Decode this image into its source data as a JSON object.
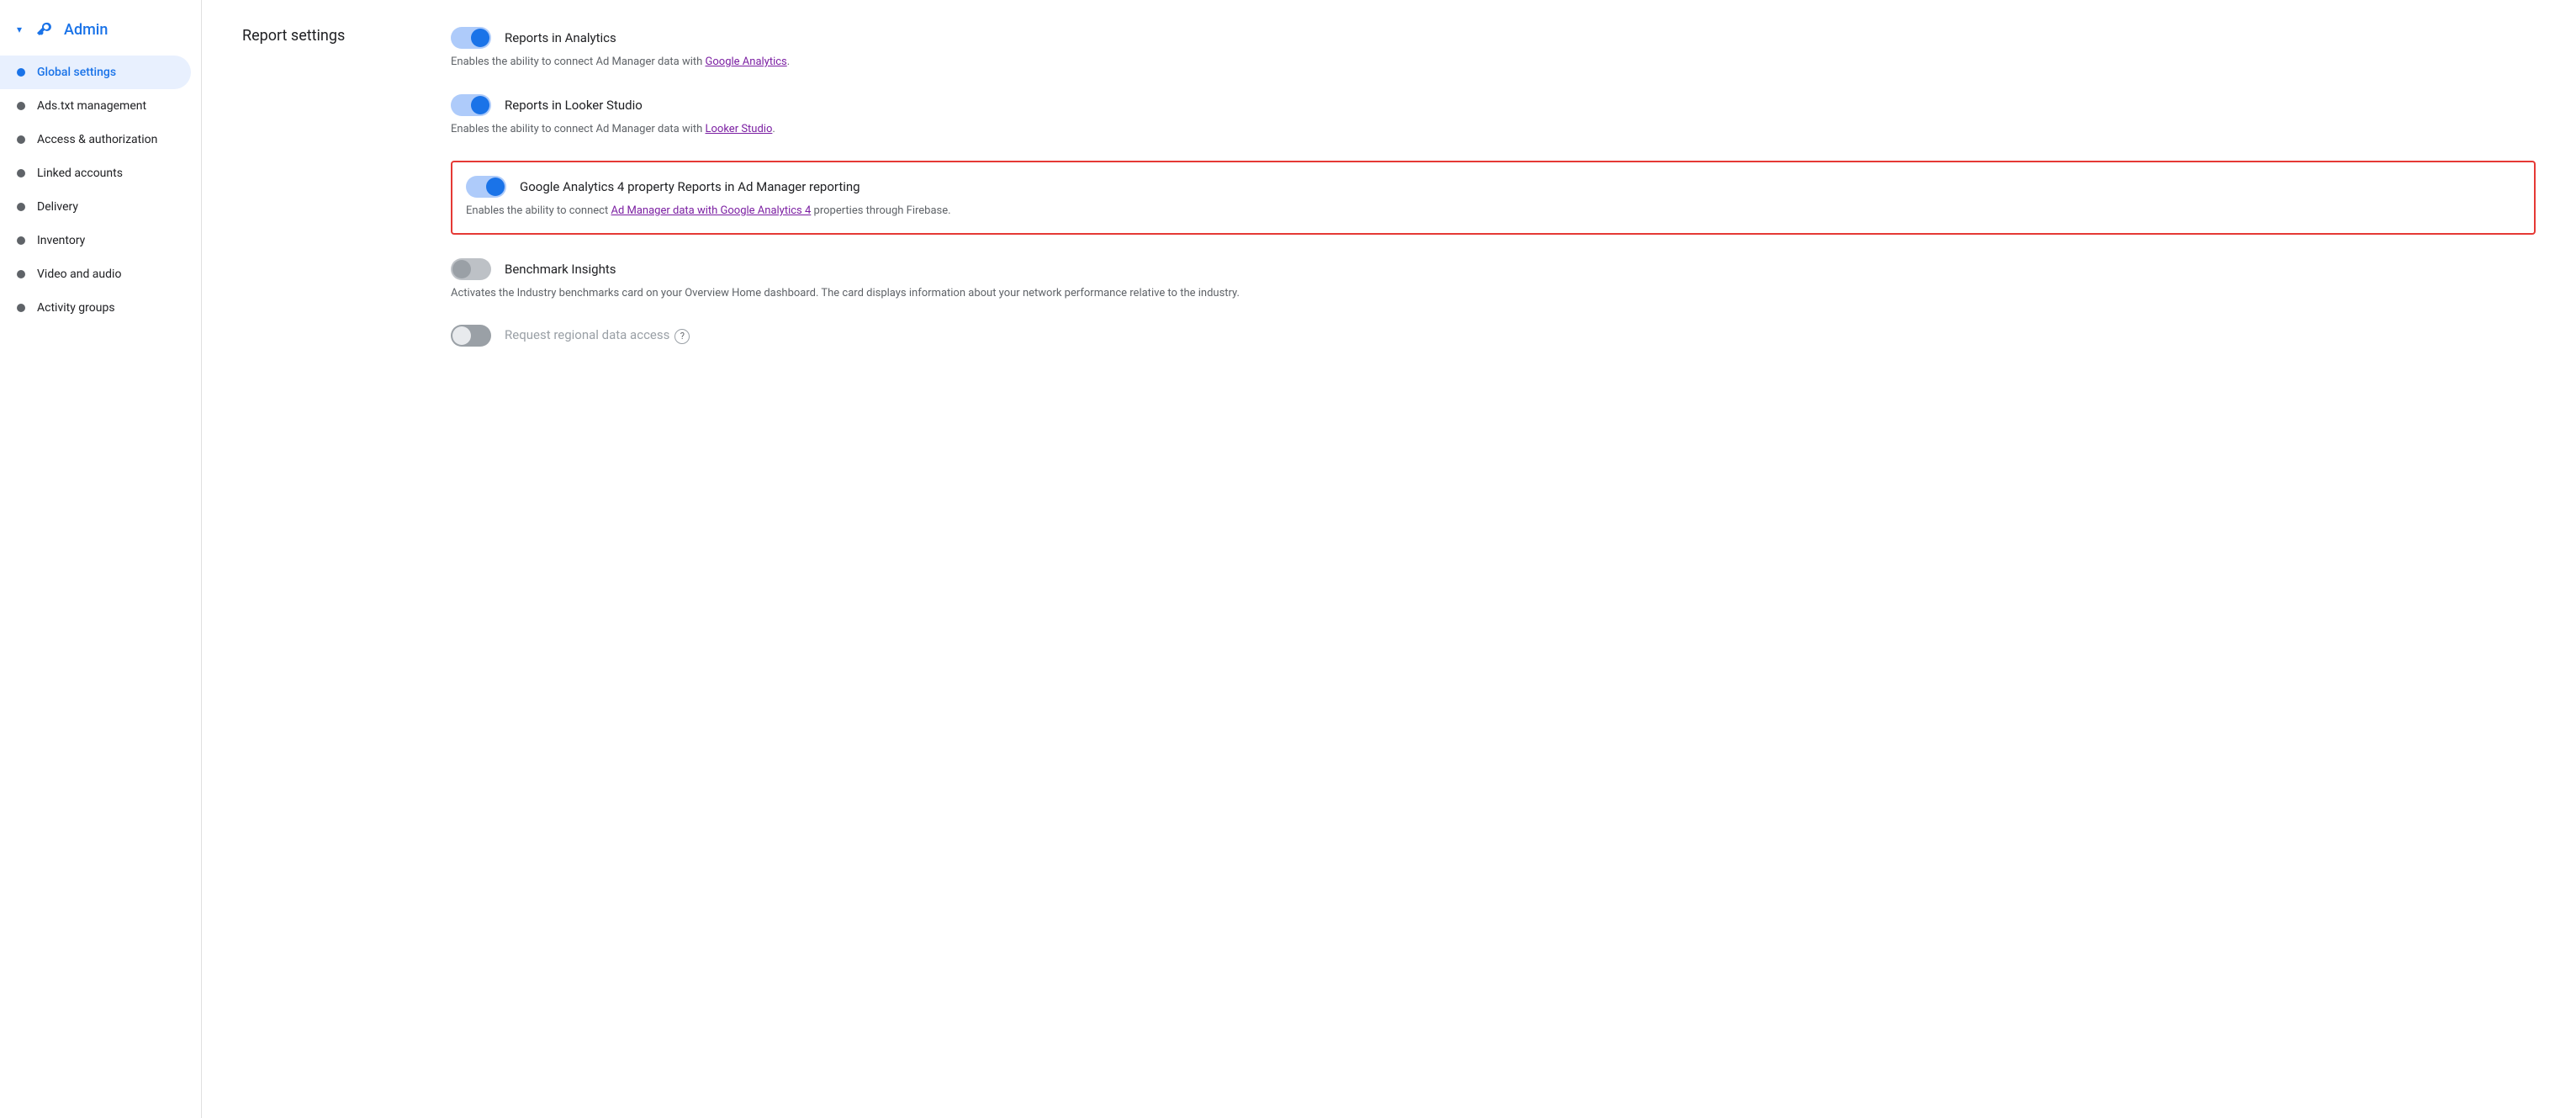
{
  "sidebar": {
    "admin_label": "Admin",
    "items": [
      {
        "id": "global-settings",
        "label": "Global settings",
        "active": true
      },
      {
        "id": "ads-txt",
        "label": "Ads.txt management",
        "active": false
      },
      {
        "id": "access-auth",
        "label": "Access & authorization",
        "active": false
      },
      {
        "id": "linked-accounts",
        "label": "Linked accounts",
        "active": false
      },
      {
        "id": "delivery",
        "label": "Delivery",
        "active": false
      },
      {
        "id": "inventory",
        "label": "Inventory",
        "active": false
      },
      {
        "id": "video-audio",
        "label": "Video and audio",
        "active": false
      },
      {
        "id": "activity-groups",
        "label": "Activity groups",
        "active": false
      }
    ]
  },
  "main": {
    "section_title": "Report settings",
    "settings": [
      {
        "id": "reports-analytics",
        "label": "Reports in Analytics",
        "description": "Enables the ability to connect Ad Manager data with ",
        "link_text": "Google Analytics",
        "description_after": ".",
        "enabled": true,
        "highlighted": false
      },
      {
        "id": "reports-looker",
        "label": "Reports in Looker Studio",
        "description": "Enables the ability to connect Ad Manager data with ",
        "link_text": "Looker Studio",
        "description_after": ".",
        "enabled": true,
        "highlighted": false
      },
      {
        "id": "ga4-reports",
        "label": "Google Analytics 4 property Reports in Ad Manager reporting",
        "description": "Enables the ability to connect ",
        "link_text": "Ad Manager data with Google Analytics 4",
        "description_after": " properties through Firebase.",
        "enabled": true,
        "highlighted": true
      },
      {
        "id": "benchmark-insights",
        "label": "Benchmark Insights",
        "description": "Activates the Industry benchmarks card on your Overview Home dashboard. The card displays information about your network performance relative to the industry.",
        "link_text": "",
        "description_after": "",
        "enabled": false,
        "highlighted": false
      },
      {
        "id": "regional-data",
        "label": "Request regional data access",
        "description": "",
        "link_text": "",
        "description_after": "",
        "enabled": false,
        "highlighted": false,
        "disabled": true,
        "has_help": true
      }
    ]
  }
}
